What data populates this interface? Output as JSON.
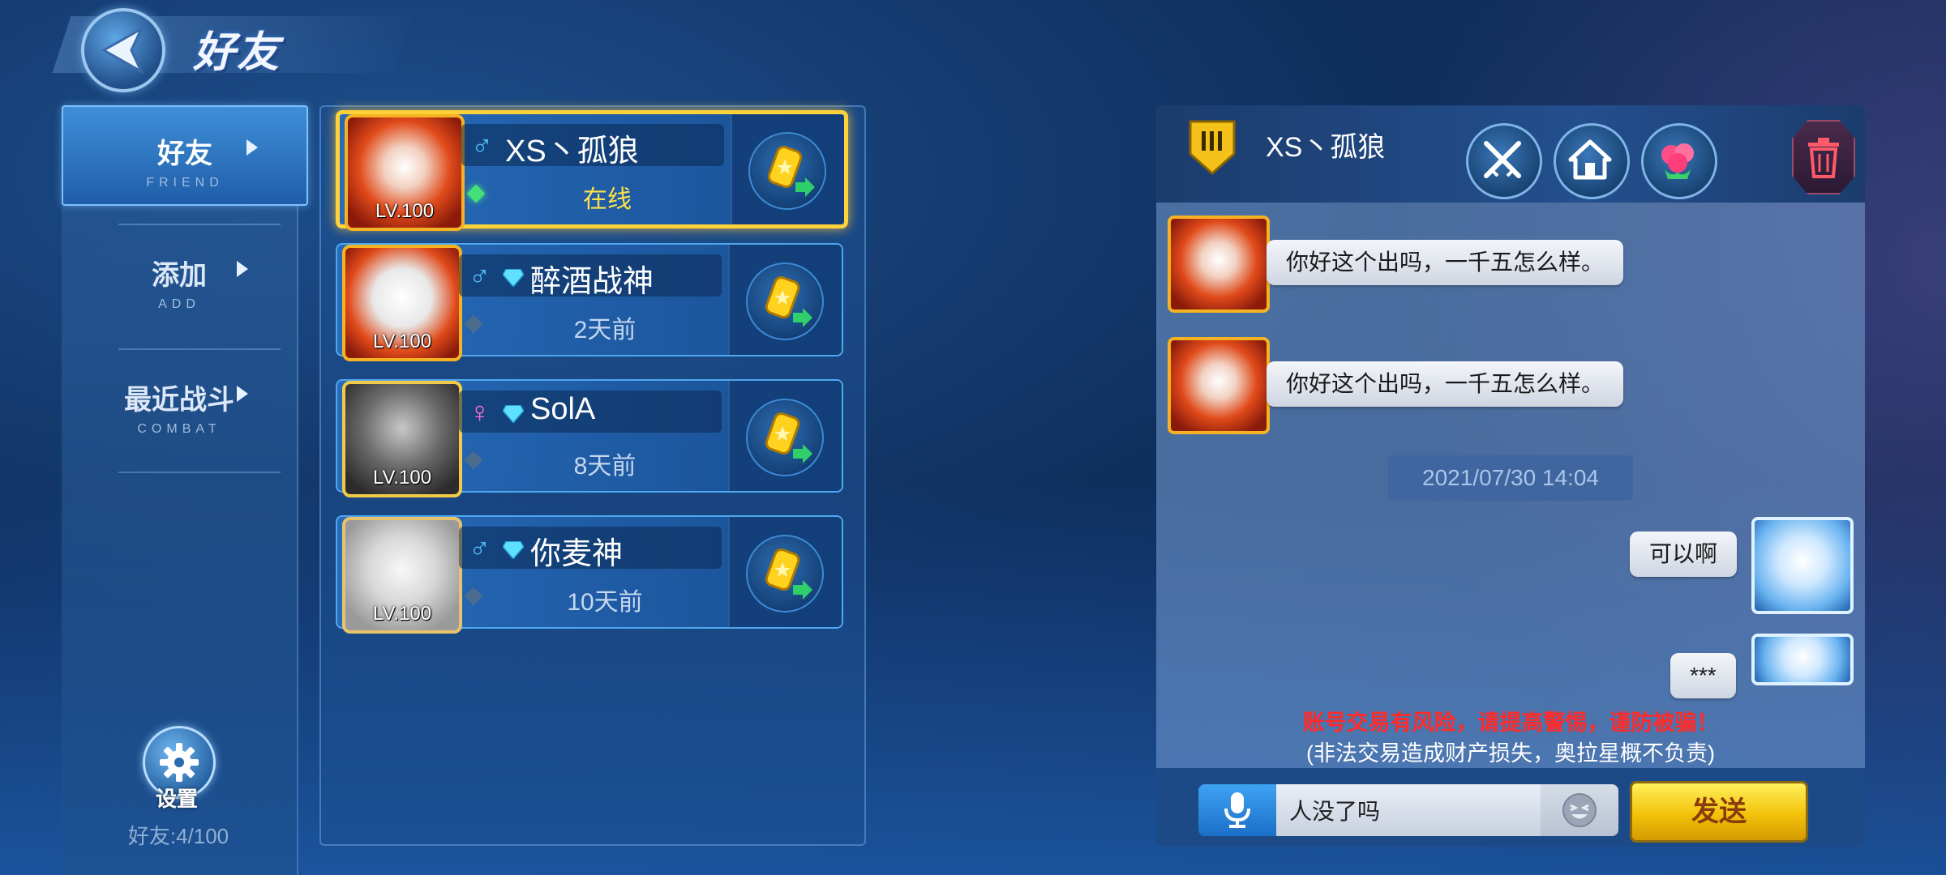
{
  "header": {
    "title": "好友"
  },
  "sidebar": {
    "items": [
      {
        "label": "好友",
        "sub": "FRIEND"
      },
      {
        "label": "添加",
        "sub": "ADD"
      },
      {
        "label": "最近战斗",
        "sub": "COMBAT"
      }
    ],
    "settings_label": "设置",
    "friend_count": "好友:4/100"
  },
  "friends": [
    {
      "name": "XS丶孤狼",
      "level": "LV.100",
      "status": "在线",
      "gender": "♂",
      "gem": false
    },
    {
      "name": "醉酒战神",
      "level": "LV.100",
      "status": "2天前",
      "gender": "♂",
      "gem": true
    },
    {
      "name": "SolA",
      "level": "LV.100",
      "status": "8天前",
      "gender": "♀",
      "gem": true
    },
    {
      "name": "你麦神",
      "level": "LV.100",
      "status": "10天前",
      "gender": "♂",
      "gem": true
    }
  ],
  "chat": {
    "title": "XS丶孤狼",
    "messages": [
      {
        "text": "你好这个出吗，一千五怎么样。"
      },
      {
        "text": "你好这个出吗，一千五怎么样。"
      },
      {
        "text": "可以啊"
      },
      {
        "text": "***"
      }
    ],
    "timestamp": "2021/07/30 14:04",
    "warning": "账号交易有风险，请提高警惕，谨防被骗！",
    "warning_sub": "(非法交易造成财产损失，奥拉星概不负责)",
    "input_value": "人没了吗",
    "send_label": "发送"
  },
  "icons": {
    "back": "back-arrow-icon",
    "settings": "gear-icon",
    "gift": "gold-coin-send-icon",
    "battle": "crossed-swords-icon",
    "home": "home-icon",
    "flowers": "roses-icon",
    "delete": "trash-icon",
    "mic": "microphone-icon",
    "emoji": "emoji-icon",
    "rank": "rank-badge-icon"
  },
  "colors": {
    "selected_border": "#ffd23a",
    "online_status": "#ffe24a",
    "warning": "#ff2a2a",
    "send_button": "#f2c20a"
  }
}
